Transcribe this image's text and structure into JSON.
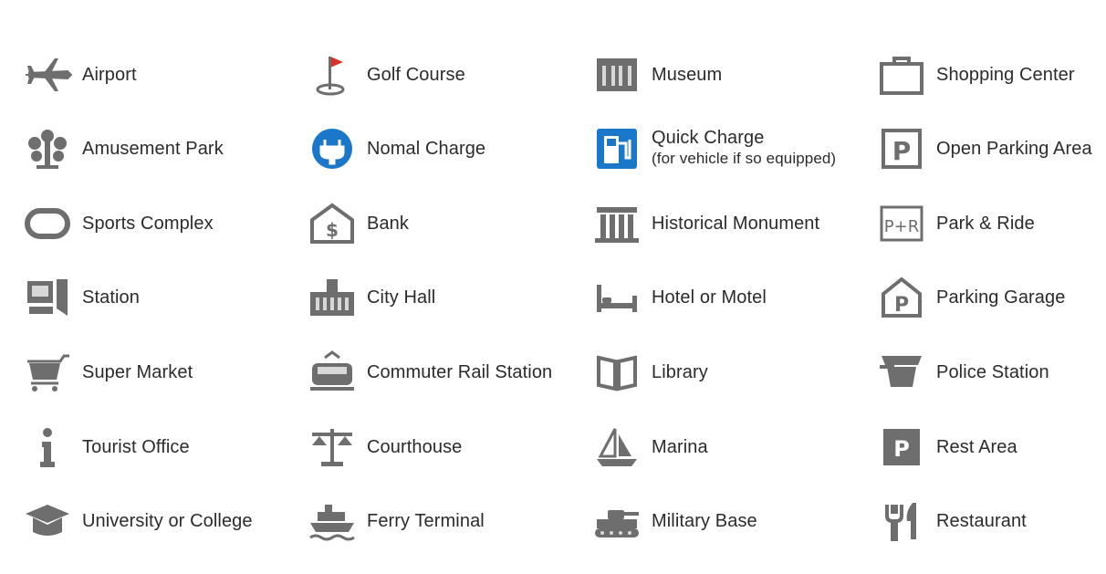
{
  "colors": {
    "icon_gray": "#7a7a7a",
    "icon_dark": "#555555",
    "golf_flag": "#d8312c",
    "charge_blue": "#1b77c9",
    "text": "#2b2b2b"
  },
  "items": [
    {
      "label": "Airport",
      "icon": "airplane-icon"
    },
    {
      "label": "Amusement Park",
      "icon": "amusement-park-icon"
    },
    {
      "label": "Sports Complex",
      "icon": "sports-complex-icon"
    },
    {
      "label": "Station",
      "icon": "station-icon"
    },
    {
      "label": "Super Market",
      "icon": "shopping-cart-icon"
    },
    {
      "label": "Tourist Office",
      "icon": "info-icon"
    },
    {
      "label": "University or College",
      "icon": "graduation-cap-icon"
    },
    {
      "label": "Golf Course",
      "icon": "golf-flag-icon"
    },
    {
      "label": "Nomal Charge",
      "icon": "plug-icon"
    },
    {
      "label": "Bank",
      "icon": "bank-icon"
    },
    {
      "label": "City Hall",
      "icon": "city-hall-icon"
    },
    {
      "label": "Commuter Rail Station",
      "icon": "rail-icon"
    },
    {
      "label": "Courthouse",
      "icon": "scales-icon"
    },
    {
      "label": "Ferry Terminal",
      "icon": "ferry-icon"
    },
    {
      "label": "Museum",
      "icon": "museum-icon"
    },
    {
      "label": "Quick Charge",
      "sub": "(for vehicle if so equipped)",
      "icon": "fuel-pump-icon"
    },
    {
      "label": "Historical Monument",
      "icon": "monument-icon"
    },
    {
      "label": "Hotel or Motel",
      "icon": "bed-icon"
    },
    {
      "label": "Library",
      "icon": "book-icon"
    },
    {
      "label": "Marina",
      "icon": "sailboat-icon"
    },
    {
      "label": "Military Base",
      "icon": "tank-icon"
    },
    {
      "label": "Shopping Center",
      "icon": "shopping-bag-icon"
    },
    {
      "label": "Open Parking Area",
      "icon": "parking-icon"
    },
    {
      "label": "Park & Ride",
      "icon": "park-and-ride-icon"
    },
    {
      "label": "Parking Garage",
      "icon": "parking-garage-icon"
    },
    {
      "label": "Police Station",
      "icon": "police-cap-icon"
    },
    {
      "label": "Rest Area",
      "icon": "rest-area-icon"
    },
    {
      "label": "Restaurant",
      "icon": "fork-knife-icon"
    }
  ]
}
